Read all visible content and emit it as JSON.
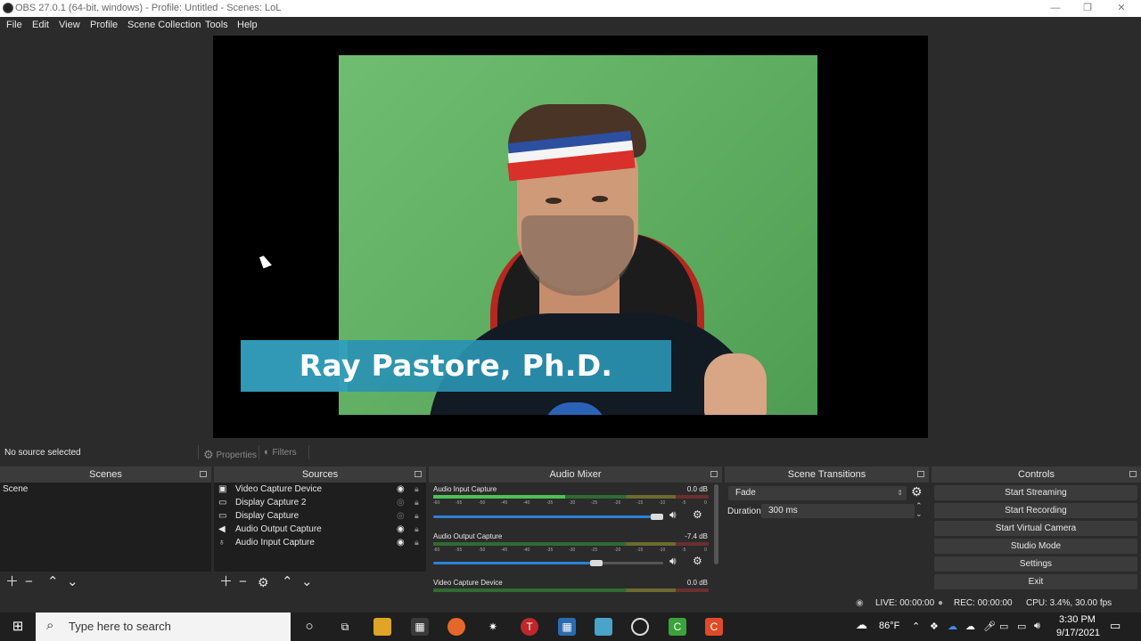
{
  "window": {
    "title": "OBS 27.0.1 (64-bit, windows) - Profile: Untitled - Scenes: LoL",
    "minimize": "—",
    "maximize": "❐",
    "close": "✕"
  },
  "menu": [
    "File",
    "Edit",
    "View",
    "Profile",
    "Scene Collection",
    "Tools",
    "Help"
  ],
  "preview": {
    "lower_third": "Ray Pastore, Ph.D."
  },
  "source_toolbar": {
    "status": "No source selected",
    "properties": "Properties",
    "filters": "Filters"
  },
  "scenes": {
    "title": "Scenes",
    "items": [
      "Scene"
    ]
  },
  "sources": {
    "title": "Sources",
    "items": [
      {
        "name": "Video Capture Device",
        "icon": "camera-icon",
        "visible": true
      },
      {
        "name": "Display Capture 2",
        "icon": "monitor-icon",
        "visible": false
      },
      {
        "name": "Display Capture",
        "icon": "monitor-icon",
        "visible": false
      },
      {
        "name": "Audio Output Capture",
        "icon": "speaker-icon",
        "visible": true
      },
      {
        "name": "Audio Input Capture",
        "icon": "microphone-icon",
        "visible": true
      }
    ]
  },
  "mixer": {
    "title": "Audio Mixer",
    "ticks": [
      "-60",
      "-55",
      "-50",
      "-45",
      "-40",
      "-35",
      "-30",
      "-25",
      "-20",
      "-15",
      "-10",
      "-5",
      "0"
    ],
    "channels": [
      {
        "name": "Audio Input Capture",
        "db": "0.0 dB",
        "level": 0.48,
        "volume": 1.0
      },
      {
        "name": "Audio Output Capture",
        "db": "-7.4 dB",
        "level": 0.0,
        "volume": 0.72
      },
      {
        "name": "Video Capture Device",
        "db": "0.0 dB",
        "level": 0.0,
        "volume": 1.0
      }
    ]
  },
  "transitions": {
    "title": "Scene Transitions",
    "selected": "Fade",
    "duration_label": "Duration",
    "duration_value": "300 ms"
  },
  "controls": {
    "title": "Controls",
    "buttons": [
      "Start Streaming",
      "Start Recording",
      "Start Virtual Camera",
      "Studio Mode",
      "Settings",
      "Exit"
    ]
  },
  "status": {
    "live": "LIVE: 00:00:00",
    "rec": "REC: 00:00:00",
    "cpu": "CPU: 3.4%, 30.00 fps"
  },
  "taskbar": {
    "search_placeholder": "Type here to search",
    "weather": "86°F",
    "time": "3:30 PM",
    "date": "9/17/2021"
  },
  "colors": {
    "accent": "#2a82da",
    "lower_third": "#2a92b2",
    "green_screen": "#5cab5f"
  }
}
